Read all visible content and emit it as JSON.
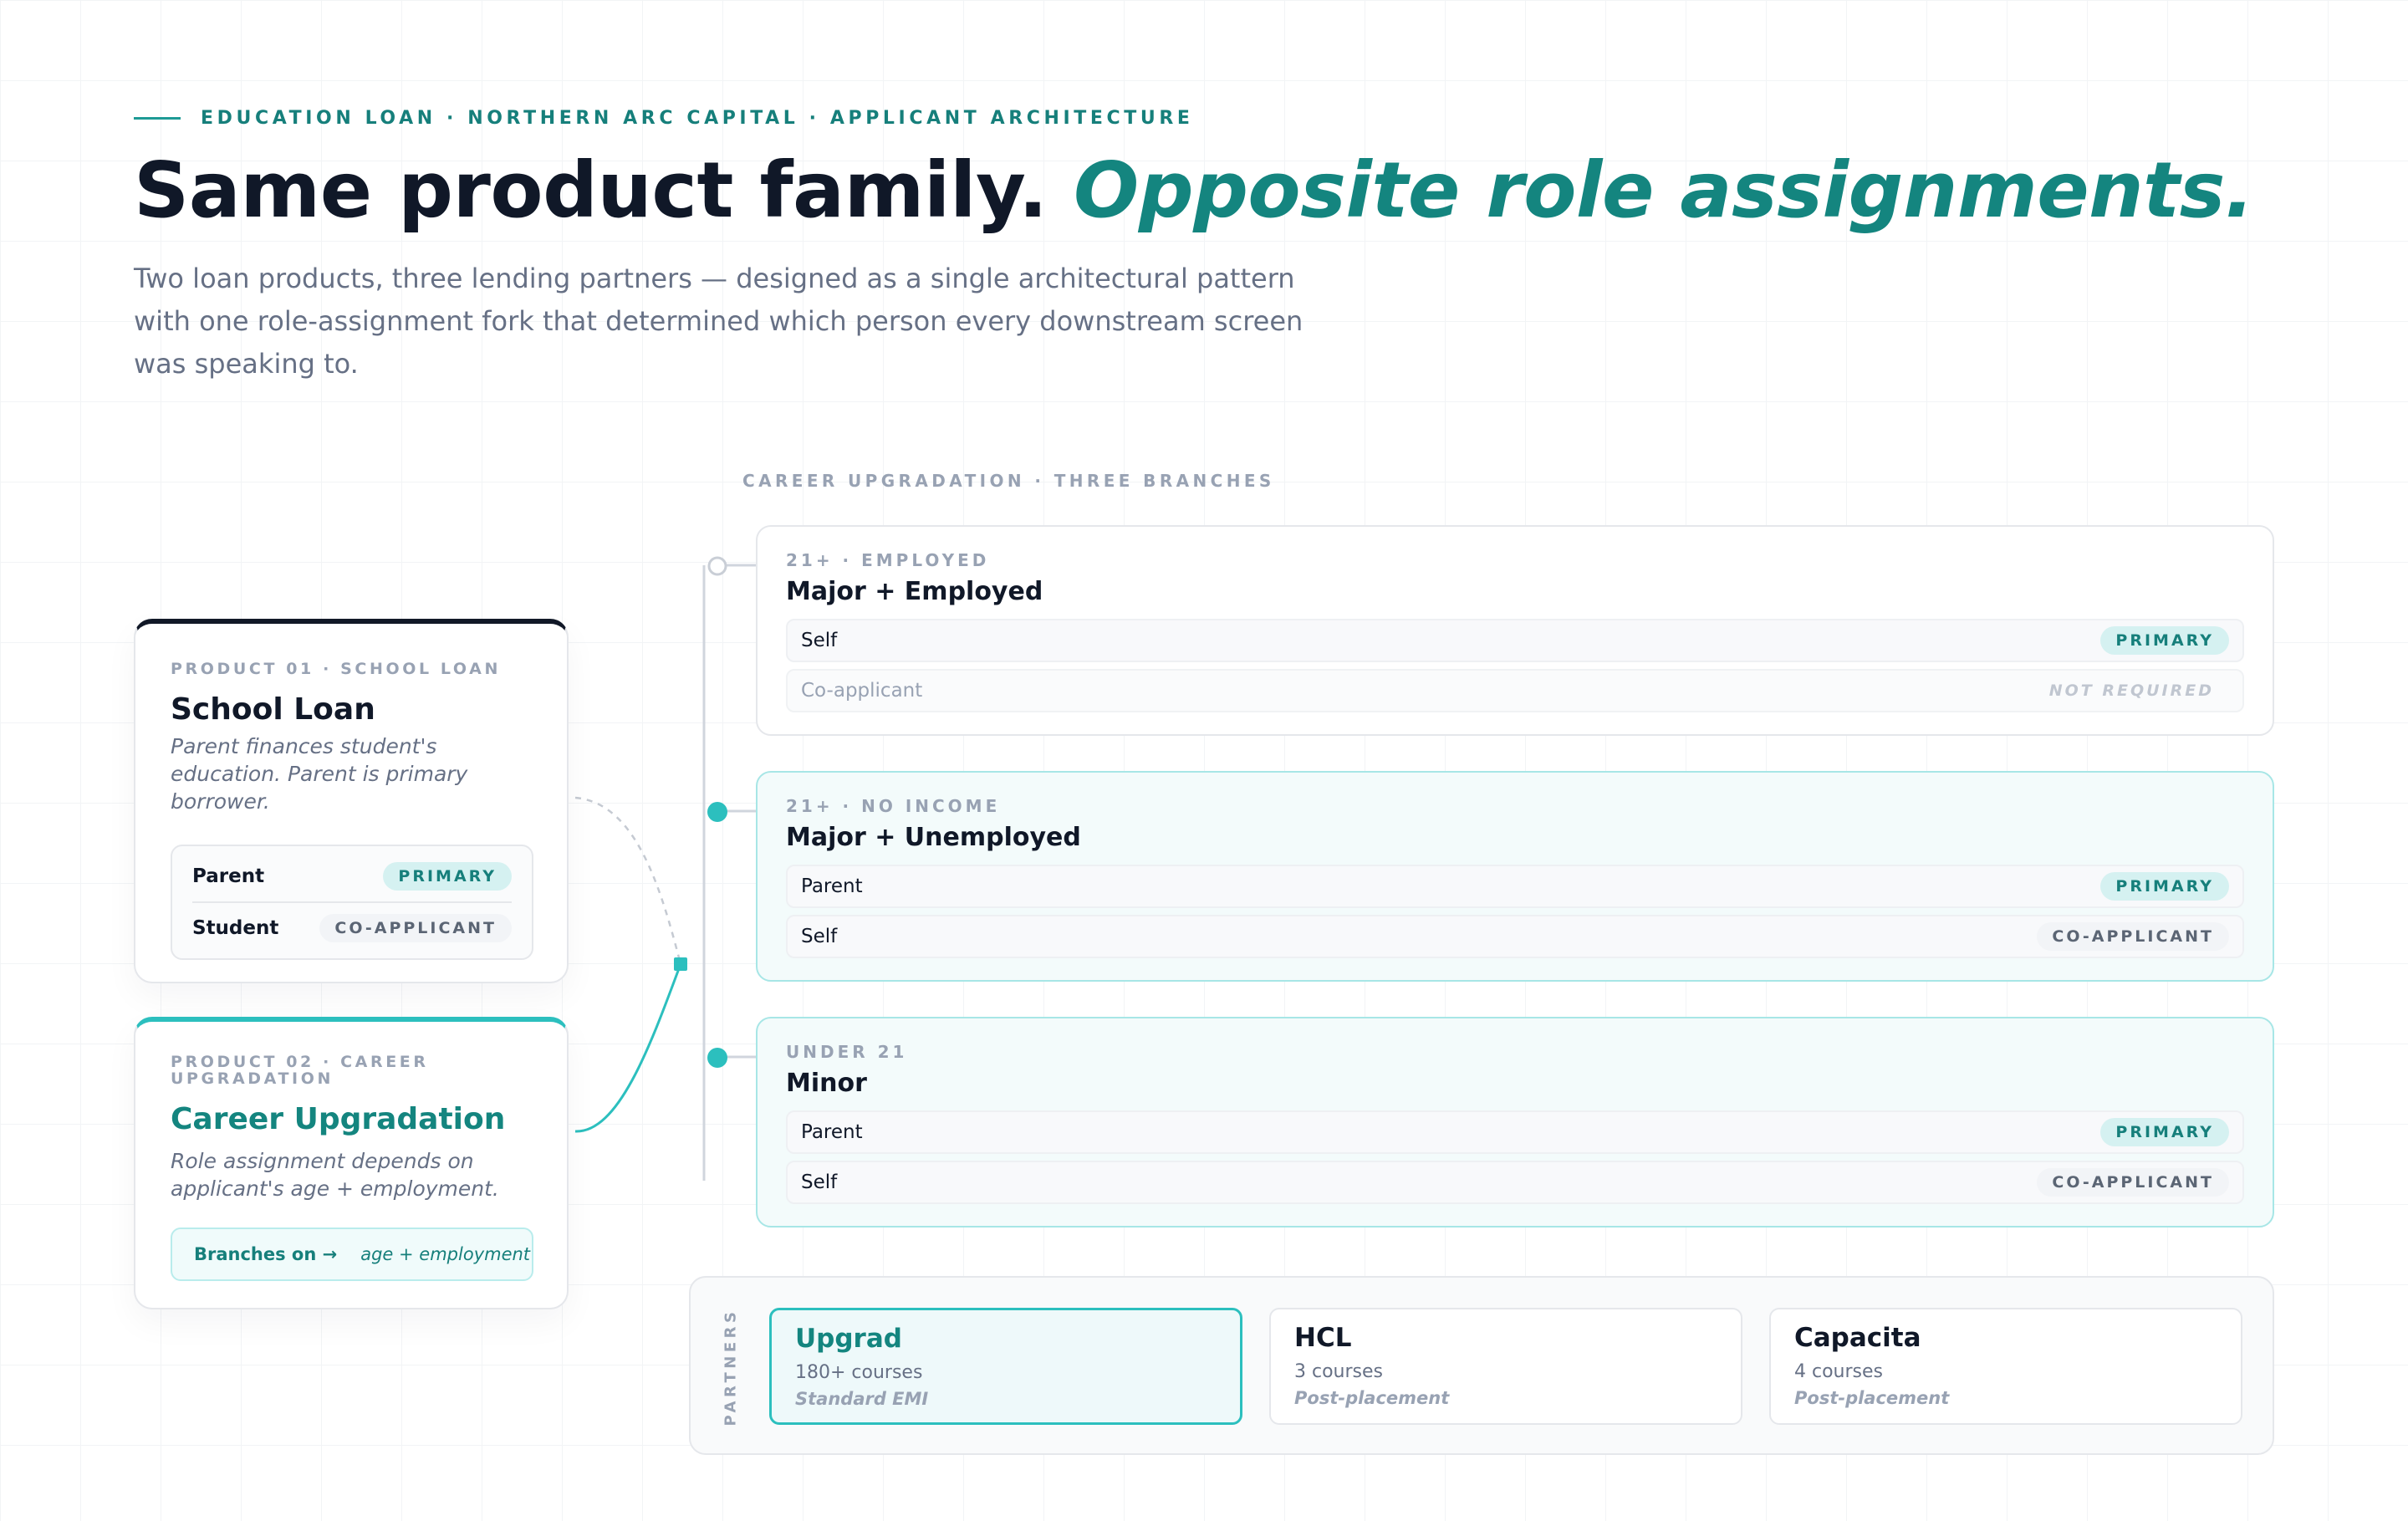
{
  "header": {
    "eyebrow": "EDUCATION LOAN · NORTHERN ARC CAPITAL · APPLICANT ARCHITECTURE",
    "headline_main": "Same product family.",
    "headline_accent": "Opposite role assignments.",
    "subtitle": "Two loan products, three lending partners — designed as a single architectural pattern with one role-assignment fork that determined which person every downstream screen was speaking to."
  },
  "products": {
    "school": {
      "eyebrow": "PRODUCT 01 · SCHOOL LOAN",
      "title": "School Loan",
      "description": "Parent finances student's education. Parent is primary borrower.",
      "roles": [
        {
          "name": "Parent",
          "badge": "PRIMARY"
        },
        {
          "name": "Student",
          "badge": "CO-APPLICANT"
        }
      ]
    },
    "career": {
      "eyebrow": "PRODUCT 02 · CAREER UPGRADATION",
      "title": "Career Upgradation",
      "description": "Role assignment depends on applicant's age + employment.",
      "branch_key": "Branches on →",
      "branch_value": "age + employment"
    }
  },
  "branches_label": "CAREER UPGRADATION · THREE BRANCHES",
  "branches": [
    {
      "eyebrow": "21+ · EMPLOYED",
      "title": "Major + Employed",
      "rows": [
        {
          "label": "Self",
          "badge": "PRIMARY"
        },
        {
          "label": "Co-applicant",
          "badge": "NOT REQUIRED"
        }
      ]
    },
    {
      "eyebrow": "21+ · NO INCOME",
      "title": "Major + Unemployed",
      "rows": [
        {
          "label": "Parent",
          "badge": "PRIMARY"
        },
        {
          "label": "Self",
          "badge": "CO-APPLICANT"
        }
      ]
    },
    {
      "eyebrow": "UNDER 21",
      "title": "Minor",
      "rows": [
        {
          "label": "Parent",
          "badge": "PRIMARY"
        },
        {
          "label": "Self",
          "badge": "CO-APPLICANT"
        }
      ]
    }
  ],
  "partners": {
    "label": "PARTNERS",
    "items": [
      {
        "name": "Upgrad",
        "courses": "180+ courses",
        "terms": "Standard EMI"
      },
      {
        "name": "HCL",
        "courses": "3 courses",
        "terms": "Post-placement"
      },
      {
        "name": "Capacita",
        "courses": "4 courses",
        "terms": "Post-placement"
      }
    ]
  },
  "colors": {
    "accent": "#14857f",
    "accent_light": "#2cbfbe",
    "ink": "#101828",
    "muted": "#667085"
  }
}
